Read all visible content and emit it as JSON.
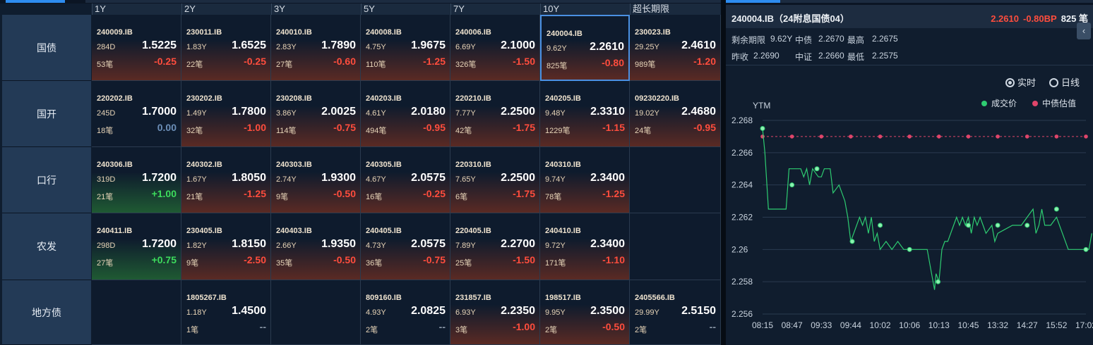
{
  "tenors": [
    "1Y",
    "2Y",
    "3Y",
    "5Y",
    "7Y",
    "10Y",
    "超长期限"
  ],
  "rows": [
    {
      "label": "国债",
      "cells": [
        {
          "code": "240009.IB",
          "term": "284D",
          "yield": "1.5225",
          "count": "53笔",
          "change": "-0.25",
          "dir": "neg"
        },
        {
          "code": "230011.IB",
          "term": "1.83Y",
          "yield": "1.6525",
          "count": "22笔",
          "change": "-0.25",
          "dir": "neg"
        },
        {
          "code": "240010.IB",
          "term": "2.83Y",
          "yield": "1.7890",
          "count": "27笔",
          "change": "-0.60",
          "dir": "neg"
        },
        {
          "code": "240008.IB",
          "term": "4.75Y",
          "yield": "1.9675",
          "count": "110笔",
          "change": "-1.25",
          "dir": "neg"
        },
        {
          "code": "240006.IB",
          "term": "6.69Y",
          "yield": "2.1000",
          "count": "326笔",
          "change": "-1.50",
          "dir": "neg"
        },
        {
          "code": "240004.IB",
          "term": "9.62Y",
          "yield": "2.2610",
          "count": "825笔",
          "change": "-0.80",
          "dir": "neg",
          "selected": true
        },
        {
          "code": "230023.IB",
          "term": "29.25Y",
          "yield": "2.4610",
          "count": "989笔",
          "change": "-1.20",
          "dir": "neg"
        }
      ]
    },
    {
      "label": "国开",
      "cells": [
        {
          "code": "220202.IB",
          "term": "245D",
          "yield": "1.7000",
          "count": "18笔",
          "change": "0.00",
          "dir": "zero"
        },
        {
          "code": "230202.IB",
          "term": "1.49Y",
          "yield": "1.7800",
          "count": "32笔",
          "change": "-1.00",
          "dir": "neg"
        },
        {
          "code": "230208.IB",
          "term": "3.86Y",
          "yield": "2.0025",
          "count": "114笔",
          "change": "-0.75",
          "dir": "neg"
        },
        {
          "code": "240203.IB",
          "term": "4.61Y",
          "yield": "2.0180",
          "count": "494笔",
          "change": "-0.95",
          "dir": "neg"
        },
        {
          "code": "220210.IB",
          "term": "7.77Y",
          "yield": "2.2500",
          "count": "42笔",
          "change": "-1.75",
          "dir": "neg"
        },
        {
          "code": "240205.IB",
          "term": "9.48Y",
          "yield": "2.3310",
          "count": "1229笔",
          "change": "-1.15",
          "dir": "neg"
        },
        {
          "code": "09230220.IB",
          "term": "19.02Y",
          "yield": "2.4680",
          "count": "24笔",
          "change": "-0.95",
          "dir": "neg"
        }
      ]
    },
    {
      "label": "口行",
      "cells": [
        {
          "code": "240306.IB",
          "term": "319D",
          "yield": "1.7200",
          "count": "21笔",
          "change": "+1.00",
          "dir": "pos"
        },
        {
          "code": "240302.IB",
          "term": "1.67Y",
          "yield": "1.8050",
          "count": "21笔",
          "change": "-1.25",
          "dir": "neg"
        },
        {
          "code": "240303.IB",
          "term": "2.74Y",
          "yield": "1.9300",
          "count": "9笔",
          "change": "-0.50",
          "dir": "neg"
        },
        {
          "code": "240305.IB",
          "term": "4.67Y",
          "yield": "2.0575",
          "count": "16笔",
          "change": "-0.25",
          "dir": "neg"
        },
        {
          "code": "220310.IB",
          "term": "7.65Y",
          "yield": "2.2500",
          "count": "6笔",
          "change": "-1.75",
          "dir": "neg"
        },
        {
          "code": "240310.IB",
          "term": "9.74Y",
          "yield": "2.3400",
          "count": "78笔",
          "change": "-1.25",
          "dir": "neg"
        },
        null
      ]
    },
    {
      "label": "农发",
      "cells": [
        {
          "code": "240411.IB",
          "term": "298D",
          "yield": "1.7200",
          "count": "27笔",
          "change": "+0.75",
          "dir": "pos"
        },
        {
          "code": "230405.IB",
          "term": "1.82Y",
          "yield": "1.8150",
          "count": "9笔",
          "change": "-2.50",
          "dir": "neg"
        },
        {
          "code": "240403.IB",
          "term": "2.66Y",
          "yield": "1.9350",
          "count": "35笔",
          "change": "-0.50",
          "dir": "neg"
        },
        {
          "code": "240405.IB",
          "term": "4.73Y",
          "yield": "2.0575",
          "count": "36笔",
          "change": "-0.75",
          "dir": "neg"
        },
        {
          "code": "220405.IB",
          "term": "7.89Y",
          "yield": "2.2700",
          "count": "25笔",
          "change": "-1.50",
          "dir": "neg"
        },
        {
          "code": "240410.IB",
          "term": "9.72Y",
          "yield": "2.3400",
          "count": "171笔",
          "change": "-1.10",
          "dir": "neg"
        },
        null
      ]
    },
    {
      "label": "地方债",
      "cells": [
        null,
        {
          "code": "1805267.IB",
          "term": "1.18Y",
          "yield": "1.4500",
          "count": "1笔",
          "change": "--",
          "dir": "dash"
        },
        null,
        {
          "code": "809160.IB",
          "term": "4.93Y",
          "yield": "2.0825",
          "count": "2笔",
          "change": "--",
          "dir": "dash"
        },
        {
          "code": "231857.IB",
          "term": "6.93Y",
          "yield": "2.2350",
          "count": "3笔",
          "change": "-1.00",
          "dir": "neg"
        },
        {
          "code": "198517.IB",
          "term": "9.95Y",
          "yield": "2.3500",
          "count": "2笔",
          "change": "-0.50",
          "dir": "neg"
        },
        {
          "code": "2405566.IB",
          "term": "29.99Y",
          "yield": "2.5150",
          "count": "2笔",
          "change": "--",
          "dir": "dash"
        }
      ]
    }
  ],
  "detail": {
    "title": "240004.IB（24附息国债04）",
    "price": "2.2610",
    "bp": "-0.80BP",
    "volume": "825 笔",
    "remaining_label": "剩余期限",
    "remaining": "9.62Y",
    "zhongzhai_label": "中债",
    "zhongzhai": "2.2670",
    "high_label": "最高",
    "high": "2.2675",
    "prev_label": "昨收",
    "prev": "2.2690",
    "zhongzheng_label": "中证",
    "zhongzheng": "2.2660",
    "low_label": "最低",
    "low": "2.2575",
    "collapse": "‹",
    "mode_realtime": "实时",
    "mode_daily": "日线",
    "legend_trade": "成交价",
    "legend_valuation": "中债估值",
    "ytm_label": "YTM"
  },
  "chart_data": {
    "type": "line",
    "ylabel": "YTM",
    "ylim": [
      2.256,
      2.268
    ],
    "yticks": [
      "2.268",
      "2.266",
      "2.264",
      "2.262",
      "2.26",
      "2.258",
      "2.256"
    ],
    "xticks": [
      "08:15",
      "08:47",
      "09:33",
      "09:44",
      "10:02",
      "10:06",
      "10:13",
      "10:45",
      "13:32",
      "14:27",
      "15:52",
      "17:02"
    ],
    "grid": true,
    "legend_position": "top-right",
    "series": [
      {
        "name": "成交价",
        "color": "#2ecc71",
        "values": [
          [
            0,
            2.2675
          ],
          [
            0.08,
            2.266
          ],
          [
            0.2,
            2.2625
          ],
          [
            0.8,
            2.2625
          ],
          [
            0.9,
            2.265
          ],
          [
            1.3,
            2.265
          ],
          [
            1.4,
            2.2645
          ],
          [
            1.5,
            2.265
          ],
          [
            1.6,
            2.264
          ],
          [
            1.7,
            2.265
          ],
          [
            1.9,
            2.2645
          ],
          [
            2.0,
            2.2645
          ],
          [
            2.1,
            2.265
          ],
          [
            2.3,
            2.265
          ],
          [
            2.4,
            2.2635
          ],
          [
            2.6,
            2.264
          ],
          [
            2.8,
            2.263
          ],
          [
            2.9,
            2.262
          ],
          [
            3.0,
            2.2605
          ],
          [
            3.1,
            2.261
          ],
          [
            3.3,
            2.262
          ],
          [
            3.4,
            2.2615
          ],
          [
            3.5,
            2.262
          ],
          [
            3.6,
            2.261
          ],
          [
            3.7,
            2.262
          ],
          [
            3.8,
            2.2605
          ],
          [
            3.9,
            2.261
          ],
          [
            4.0,
            2.26
          ],
          [
            4.2,
            2.2605
          ],
          [
            4.4,
            2.26
          ],
          [
            4.6,
            2.2605
          ],
          [
            4.8,
            2.26
          ],
          [
            5.0,
            2.26
          ],
          [
            5.4,
            2.26
          ],
          [
            5.6,
            2.26
          ],
          [
            5.7,
            2.259
          ],
          [
            5.8,
            2.258
          ],
          [
            5.85,
            2.2575
          ],
          [
            5.9,
            2.2585
          ],
          [
            6.0,
            2.258
          ],
          [
            6.05,
            2.259
          ],
          [
            6.1,
            2.26
          ],
          [
            6.2,
            2.2605
          ],
          [
            6.3,
            2.2605
          ],
          [
            6.5,
            2.2615
          ],
          [
            6.6,
            2.262
          ],
          [
            6.7,
            2.2615
          ],
          [
            6.8,
            2.262
          ],
          [
            6.9,
            2.2615
          ],
          [
            7.0,
            2.262
          ],
          [
            7.1,
            2.261
          ],
          [
            7.2,
            2.262
          ],
          [
            7.3,
            2.2615
          ],
          [
            7.4,
            2.262
          ],
          [
            7.5,
            2.2615
          ],
          [
            7.6,
            2.261
          ],
          [
            7.8,
            2.2615
          ],
          [
            7.9,
            2.2605
          ],
          [
            8.0,
            2.261
          ],
          [
            8.2,
            2.2612
          ],
          [
            8.5,
            2.2615
          ],
          [
            8.8,
            2.2615
          ],
          [
            9.0,
            2.262
          ],
          [
            9.2,
            2.2625
          ],
          [
            9.3,
            2.261
          ],
          [
            9.4,
            2.2615
          ],
          [
            9.5,
            2.2625
          ],
          [
            9.6,
            2.2615
          ],
          [
            9.8,
            2.2615
          ],
          [
            10.0,
            2.262
          ],
          [
            10.2,
            2.261
          ],
          [
            10.4,
            2.26
          ],
          [
            10.6,
            2.26
          ],
          [
            10.8,
            2.26
          ],
          [
            11.0,
            2.26
          ],
          [
            11.1,
            2.26
          ],
          [
            11.2,
            2.261
          ]
        ]
      },
      {
        "name": "中债估值",
        "color": "#e0456a",
        "values": [
          [
            0,
            2.267
          ],
          [
            11,
            2.267
          ]
        ]
      }
    ],
    "markers": [
      [
        0,
        2.2675
      ],
      [
        1,
        2.264
      ],
      [
        1.85,
        2.265
      ],
      [
        3.05,
        2.2605
      ],
      [
        4.0,
        2.2615
      ],
      [
        5.0,
        2.26
      ],
      [
        5.97,
        2.258
      ],
      [
        7.0,
        2.2615
      ],
      [
        8.0,
        2.2615
      ],
      [
        9.0,
        2.2615
      ],
      [
        10.0,
        2.2625
      ],
      [
        11.0,
        2.26
      ]
    ],
    "valuation_markers": [
      0,
      1,
      2,
      3,
      4,
      5,
      6,
      7,
      8,
      9,
      10,
      11
    ]
  }
}
